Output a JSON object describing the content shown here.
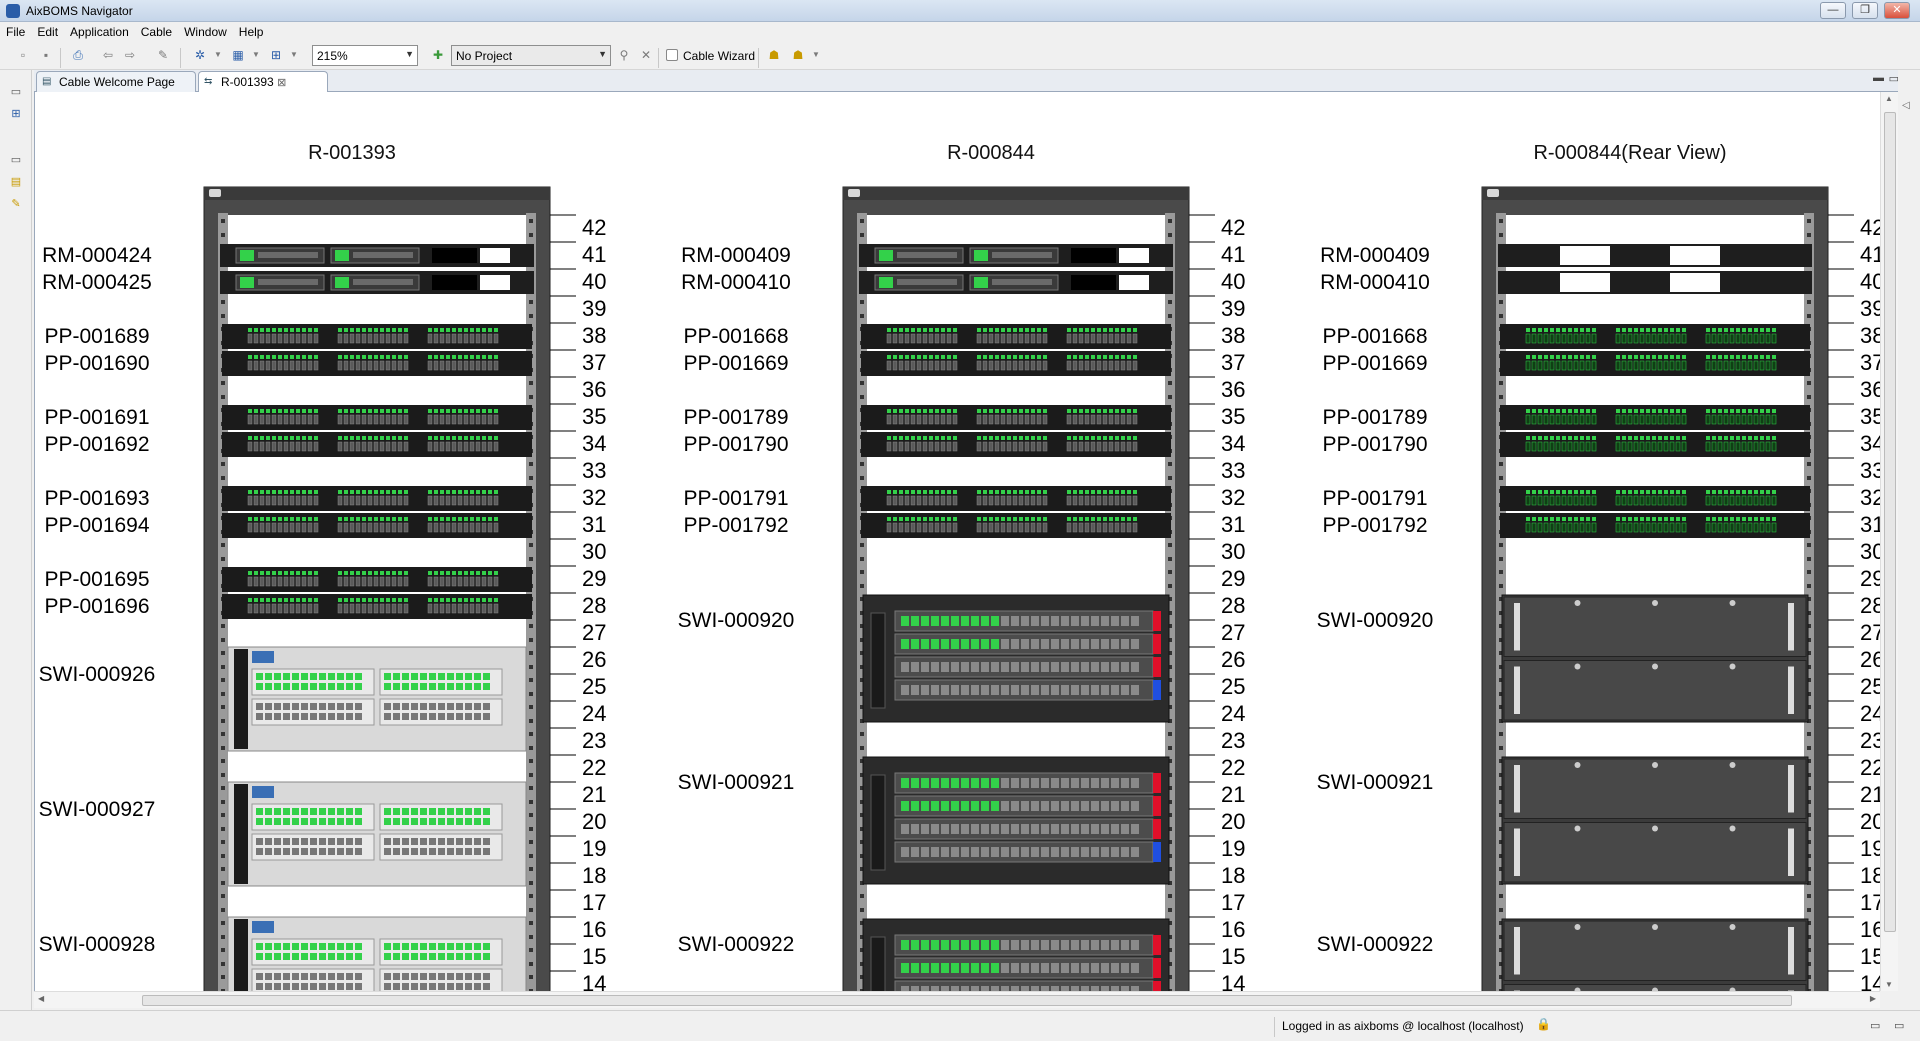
{
  "window": {
    "title": "AixBOMS Navigator",
    "minimize": "—",
    "maximize": "❐",
    "close": "✕"
  },
  "menu": [
    "File",
    "Edit",
    "Application",
    "Cable",
    "Window",
    "Help"
  ],
  "toolbar": {
    "zoom": "215%",
    "project": "No Project",
    "cable_wizard": "Cable Wizard"
  },
  "tabs": [
    {
      "label": "Cable Welcome Page",
      "active": false
    },
    {
      "label": "R-001393",
      "active": true,
      "close": "⊠"
    }
  ],
  "status": {
    "text": "Logged in as aixboms @ localhost (localhost)"
  },
  "racks": [
    {
      "title": "R-001393",
      "view": "front",
      "devices": [
        {
          "label": "RM-000424",
          "type": "rm",
          "top_unit": 41,
          "units": 1
        },
        {
          "label": "RM-000425",
          "type": "rm",
          "top_unit": 40,
          "units": 1
        },
        {
          "label": "PP-001689",
          "type": "pp",
          "top_unit": 38,
          "units": 1
        },
        {
          "label": "PP-001690",
          "type": "pp",
          "top_unit": 37,
          "units": 1
        },
        {
          "label": "PP-001691",
          "type": "pp",
          "top_unit": 35,
          "units": 1
        },
        {
          "label": "PP-001692",
          "type": "pp",
          "top_unit": 34,
          "units": 1
        },
        {
          "label": "PP-001693",
          "type": "pp",
          "top_unit": 32,
          "units": 1
        },
        {
          "label": "PP-001694",
          "type": "pp",
          "top_unit": 31,
          "units": 1
        },
        {
          "label": "PP-001695",
          "type": "pp",
          "top_unit": 29,
          "units": 1
        },
        {
          "label": "PP-001696",
          "type": "pp",
          "top_unit": 28,
          "units": 1
        },
        {
          "label": "SWI-000926",
          "type": "hp",
          "top_unit": 26,
          "units": 4
        },
        {
          "label": "SWI-000927",
          "type": "hp",
          "top_unit": 21,
          "units": 4
        },
        {
          "label": "SWI-000928",
          "type": "hp",
          "top_unit": 16,
          "units": 4
        }
      ]
    },
    {
      "title": "R-000844",
      "view": "front",
      "devices": [
        {
          "label": "RM-000409",
          "type": "rm",
          "top_unit": 41,
          "units": 1
        },
        {
          "label": "RM-000410",
          "type": "rm",
          "top_unit": 40,
          "units": 1
        },
        {
          "label": "PP-001668",
          "type": "pp",
          "top_unit": 38,
          "units": 1
        },
        {
          "label": "PP-001669",
          "type": "pp",
          "top_unit": 37,
          "units": 1
        },
        {
          "label": "PP-001789",
          "type": "pp",
          "top_unit": 35,
          "units": 1
        },
        {
          "label": "PP-001790",
          "type": "pp",
          "top_unit": 34,
          "units": 1
        },
        {
          "label": "PP-001791",
          "type": "pp",
          "top_unit": 32,
          "units": 1
        },
        {
          "label": "PP-001792",
          "type": "pp",
          "top_unit": 31,
          "units": 1
        },
        {
          "label": "SWI-000920",
          "type": "cisco",
          "top_unit": 28,
          "units": 5
        },
        {
          "label": "SWI-000921",
          "type": "cisco",
          "top_unit": 22,
          "units": 5
        },
        {
          "label": "SWI-000922",
          "type": "cisco",
          "top_unit": 16,
          "units": 5
        }
      ]
    },
    {
      "title": "R-000844(Rear View)",
      "view": "rear",
      "devices": [
        {
          "label": "RM-000409",
          "type": "rm",
          "top_unit": 41,
          "units": 1
        },
        {
          "label": "RM-000410",
          "type": "rm",
          "top_unit": 40,
          "units": 1
        },
        {
          "label": "PP-001668",
          "type": "pp",
          "top_unit": 38,
          "units": 1
        },
        {
          "label": "PP-001669",
          "type": "pp",
          "top_unit": 37,
          "units": 1
        },
        {
          "label": "PP-001789",
          "type": "pp",
          "top_unit": 35,
          "units": 1
        },
        {
          "label": "PP-001790",
          "type": "pp",
          "top_unit": 34,
          "units": 1
        },
        {
          "label": "PP-001791",
          "type": "pp",
          "top_unit": 32,
          "units": 1
        },
        {
          "label": "PP-001792",
          "type": "pp",
          "top_unit": 31,
          "units": 1
        },
        {
          "label": "SWI-000920",
          "type": "cisco",
          "top_unit": 28,
          "units": 5
        },
        {
          "label": "SWI-000921",
          "type": "cisco",
          "top_unit": 22,
          "units": 5
        },
        {
          "label": "SWI-000922",
          "type": "cisco",
          "top_unit": 16,
          "units": 5
        }
      ]
    }
  ],
  "unit_numbers": [
    "42",
    "41",
    "40",
    "39",
    "38",
    "37",
    "36",
    "35",
    "34",
    "33",
    "32",
    "31",
    "30",
    "29",
    "28",
    "27",
    "26",
    "25",
    "24",
    "23",
    "22",
    "21",
    "20",
    "19",
    "18",
    "17",
    "16",
    "15",
    "14"
  ],
  "colors": {
    "port_green": "#33d14a",
    "rack_dark": "#2b2b2b",
    "cisco_red": "#e0102a",
    "cisco_blue": "#1f4fe0"
  }
}
